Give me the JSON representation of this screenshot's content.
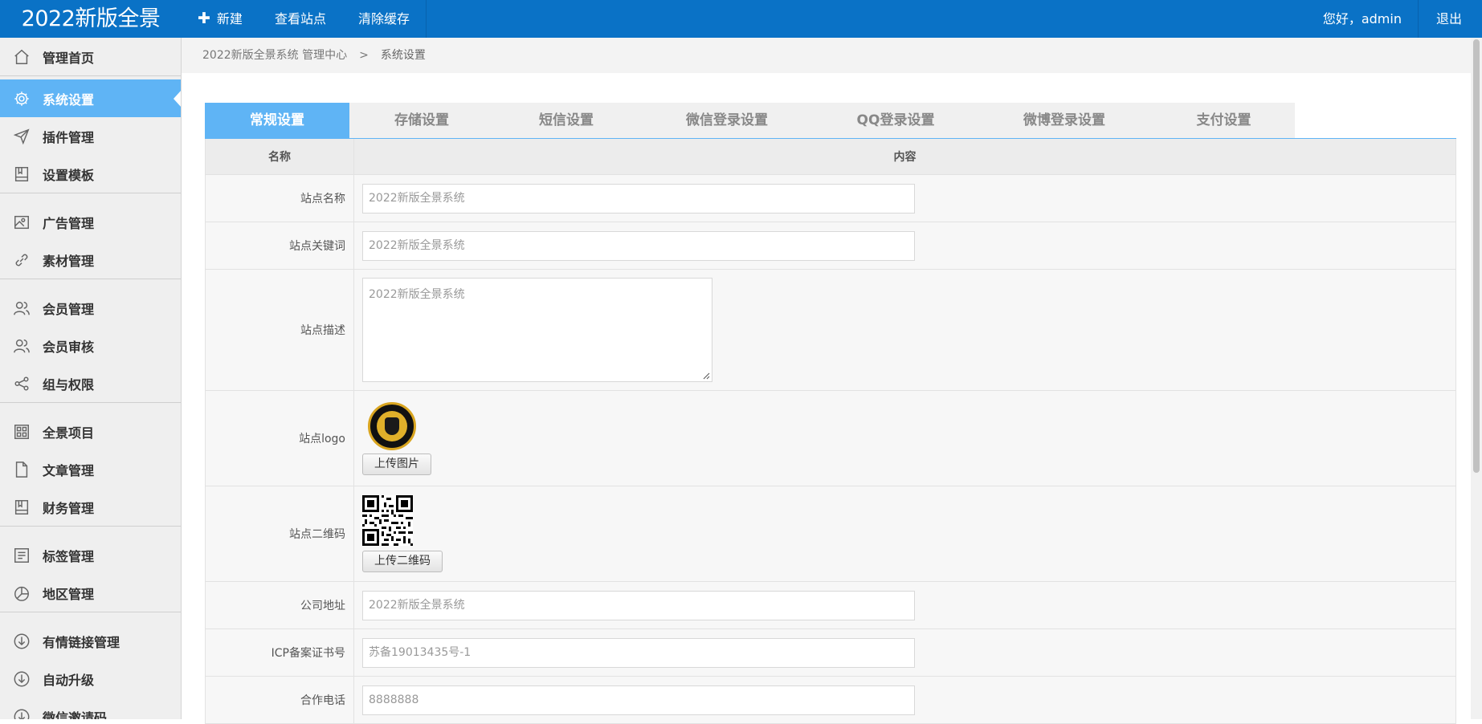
{
  "app": {
    "brand": "2022新版全景"
  },
  "topnav": {
    "new_label": "新建",
    "view_site": "查看站点",
    "clear_cache": "清除缓存"
  },
  "user": {
    "greeting": "您好，admin",
    "logout": "退出"
  },
  "sidebar": {
    "items": [
      {
        "label": "管理首页",
        "icon": "home-icon"
      },
      {
        "label": "系统设置",
        "icon": "gear-icon"
      },
      {
        "label": "插件管理",
        "icon": "send-icon"
      },
      {
        "label": "设置模板",
        "icon": "book-icon"
      },
      {
        "label": "广告管理",
        "icon": "image-icon"
      },
      {
        "label": "素材管理",
        "icon": "link-icon"
      },
      {
        "label": "会员管理",
        "icon": "users-icon"
      },
      {
        "label": "会员审核",
        "icon": "users-icon"
      },
      {
        "label": "组与权限",
        "icon": "share-icon"
      },
      {
        "label": "全景项目",
        "icon": "grid-icon"
      },
      {
        "label": "文章管理",
        "icon": "file-icon"
      },
      {
        "label": "财务管理",
        "icon": "book-icon"
      },
      {
        "label": "标签管理",
        "icon": "list-icon"
      },
      {
        "label": "地区管理",
        "icon": "pie-icon"
      },
      {
        "label": "有情链接管理",
        "icon": "download-icon"
      },
      {
        "label": "自动升级",
        "icon": "download-icon"
      },
      {
        "label": "微信邀请码",
        "icon": "download-icon"
      }
    ]
  },
  "breadcrumb": {
    "root": "2022新版全景系统 管理中心",
    "separator": ">",
    "current": "系统设置"
  },
  "tabs": [
    {
      "label": "常规设置"
    },
    {
      "label": "存储设置"
    },
    {
      "label": "短信设置"
    },
    {
      "label": "微信登录设置"
    },
    {
      "label": "QQ登录设置"
    },
    {
      "label": "微博登录设置"
    },
    {
      "label": "支付设置"
    }
  ],
  "table": {
    "head_name": "名称",
    "head_content": "内容",
    "site_name": {
      "label": "站点名称",
      "value": "2022新版全景系统"
    },
    "site_keywords": {
      "label": "站点关键词",
      "value": "2022新版全景系统"
    },
    "site_desc": {
      "label": "站点描述",
      "value": "2022新版全景系统"
    },
    "site_logo": {
      "label": "站点logo",
      "button": "上传图片"
    },
    "site_qr": {
      "label": "站点二维码",
      "button": "上传二维码"
    },
    "company_address": {
      "label": "公司地址",
      "value": "2022新版全景系统"
    },
    "icp": {
      "label": "ICP备案证书号",
      "value": "苏备19013435号-1"
    },
    "phone": {
      "label": "合作电话",
      "value": "8888888"
    }
  },
  "colors": {
    "topbar": "#0a72c6",
    "accent": "#5fb4f5"
  }
}
